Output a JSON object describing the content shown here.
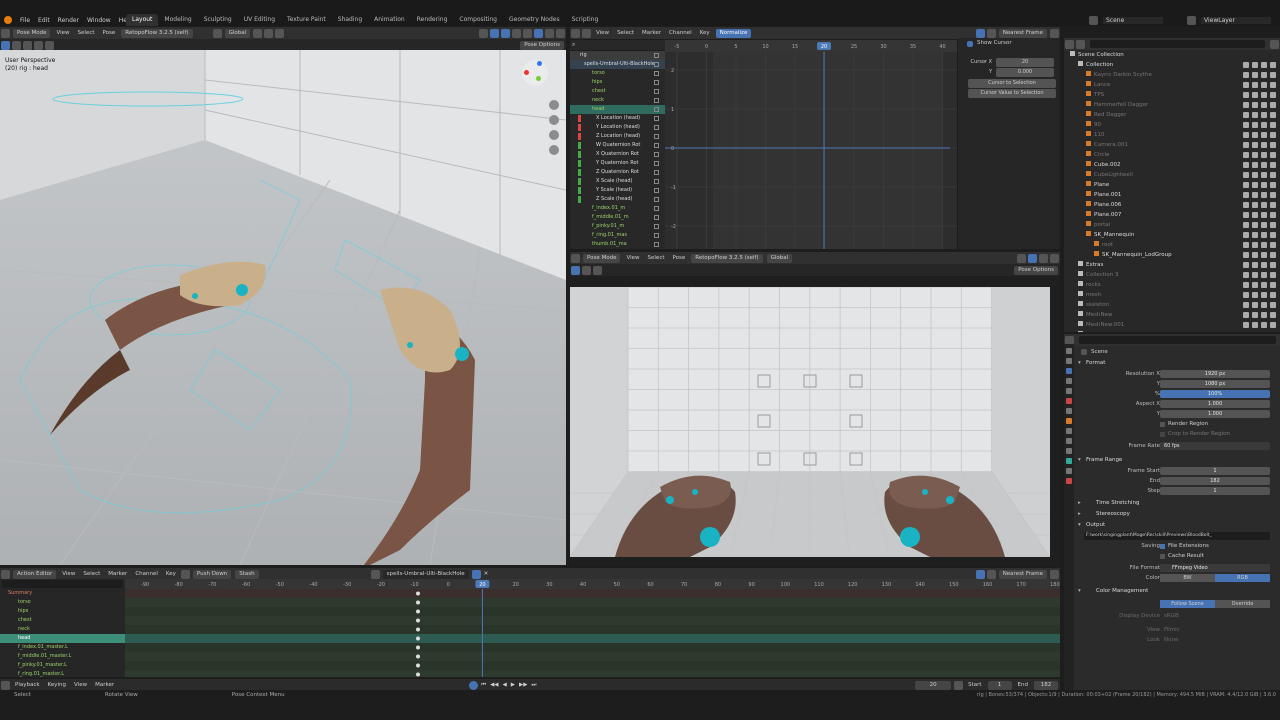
{
  "app_menu": [
    "File",
    "Edit",
    "Render",
    "Window",
    "Help"
  ],
  "workspaces": [
    "Layout",
    "Modeling",
    "Sculpting",
    "UV Editing",
    "Texture Paint",
    "Shading",
    "Animation",
    "Rendering",
    "Compositing",
    "Geometry Nodes",
    "Scripting"
  ],
  "active_workspace": "Layout",
  "scene_name": "Scene",
  "view_layer": "ViewLayer",
  "viewport3d": {
    "header": {
      "mode": "Pose Mode",
      "menus": [
        "View",
        "Select",
        "Pose"
      ],
      "addon": "RetopoFlow 3.2.5 (self)",
      "orientation": "Global",
      "options": "Pose Options"
    },
    "overlay_title": "User Perspective",
    "overlay_sub": "(20) rig : head"
  },
  "graph_editor": {
    "header": {
      "menus": [
        "View",
        "Select",
        "Marker",
        "Channel",
        "Key"
      ],
      "normalize": "Normalize",
      "pivot": "Nearest Frame"
    },
    "channels": [
      {
        "name": "rig",
        "type": "obj"
      },
      {
        "name": "spells-Umbral-Ulti-BlackHole",
        "type": "action"
      },
      {
        "name": "torso",
        "type": "bone"
      },
      {
        "name": "hips",
        "type": "bone"
      },
      {
        "name": "chest",
        "type": "bone"
      },
      {
        "name": "neck",
        "type": "bone"
      },
      {
        "name": "head",
        "type": "bone-sel"
      },
      {
        "name": "X Location (head)",
        "type": "fc"
      },
      {
        "name": "Y Location (head)",
        "type": "fc"
      },
      {
        "name": "Z Location (head)",
        "type": "fc"
      },
      {
        "name": "W Quaternion Rot",
        "type": "fc"
      },
      {
        "name": "X Quaternion Rot",
        "type": "fc"
      },
      {
        "name": "Y Quaternion Rot",
        "type": "fc"
      },
      {
        "name": "Z Quaternion Rot",
        "type": "fc"
      },
      {
        "name": "X Scale (head)",
        "type": "fc"
      },
      {
        "name": "Y Scale (head)",
        "type": "fc"
      },
      {
        "name": "Z Scale (head)",
        "type": "fc"
      },
      {
        "name": "f_index.01_m",
        "type": "bone"
      },
      {
        "name": "f_middle.01_m",
        "type": "bone"
      },
      {
        "name": "f_pinky.01_m",
        "type": "bone"
      },
      {
        "name": "f_ring.01_mas",
        "type": "bone"
      },
      {
        "name": "thumb.01_ma",
        "type": "bone"
      }
    ],
    "ruler": [
      "-5",
      "0",
      "5",
      "10",
      "15",
      "20",
      "25",
      "30",
      "35",
      "40"
    ],
    "current_frame": "20",
    "y_ticks": [
      "2",
      "1",
      "0",
      "-1",
      "-2"
    ],
    "npanel": {
      "show_cursor": "Show Cursor",
      "cursor_x_label": "Cursor X",
      "cursor_x": "20",
      "cursor_y_label": "Y",
      "cursor_y": "0.000",
      "btn1": "Cursor to Selection",
      "btn2": "Cursor Value to Selection"
    }
  },
  "viewport2": {
    "header": {
      "mode": "Pose Mode",
      "menus": [
        "View",
        "Select",
        "Pose"
      ],
      "addon": "RetopoFlow 3.2.5 (self)",
      "orientation": "Global",
      "options": "Pose Options"
    }
  },
  "outliner": {
    "items": [
      {
        "name": "Scene Collection",
        "indent": 0,
        "color": "#ddd"
      },
      {
        "name": "Collection",
        "indent": 1,
        "color": "#ddd"
      },
      {
        "name": "Kayrrc Darkin Scythe",
        "indent": 2,
        "color": "#777"
      },
      {
        "name": "Lance",
        "indent": 2,
        "color": "#777"
      },
      {
        "name": "TPS",
        "indent": 2,
        "color": "#777"
      },
      {
        "name": "Hammerfell Dagger",
        "indent": 2,
        "color": "#777"
      },
      {
        "name": "Red Dagger",
        "indent": 2,
        "color": "#777"
      },
      {
        "name": "90",
        "indent": 2,
        "color": "#777"
      },
      {
        "name": "110",
        "indent": 2,
        "color": "#777"
      },
      {
        "name": "Camera.001",
        "indent": 2,
        "color": "#777"
      },
      {
        "name": "Circle",
        "indent": 2,
        "color": "#777"
      },
      {
        "name": "Cube.002",
        "indent": 2,
        "color": "#ddd"
      },
      {
        "name": "CubeLightwell",
        "indent": 2,
        "color": "#777"
      },
      {
        "name": "Plane",
        "indent": 2,
        "color": "#ddd"
      },
      {
        "name": "Plane.001",
        "indent": 2,
        "color": "#ddd"
      },
      {
        "name": "Plane.006",
        "indent": 2,
        "color": "#ddd"
      },
      {
        "name": "Plane.007",
        "indent": 2,
        "color": "#ddd"
      },
      {
        "name": "portal",
        "indent": 2,
        "color": "#777"
      },
      {
        "name": "SK_Mannequin",
        "indent": 2,
        "color": "#ddd"
      },
      {
        "name": "root",
        "indent": 3,
        "color": "#777"
      },
      {
        "name": "SK_Mannequin_LodGroup",
        "indent": 3,
        "color": "#ddd"
      },
      {
        "name": "Extras",
        "indent": 1,
        "color": "#ddd"
      },
      {
        "name": "Collection 3",
        "indent": 1,
        "color": "#777"
      },
      {
        "name": "rocks",
        "indent": 1,
        "color": "#777"
      },
      {
        "name": "mesh",
        "indent": 1,
        "color": "#777"
      },
      {
        "name": "skeleton",
        "indent": 1,
        "color": "#777"
      },
      {
        "name": "MeshNew",
        "indent": 1,
        "color": "#777"
      },
      {
        "name": "MeshNew.001",
        "indent": 1,
        "color": "#777"
      },
      {
        "name": "Crossbow.R",
        "indent": 1,
        "color": "#777"
      }
    ]
  },
  "properties": {
    "context": "Scene",
    "format_label": "Format",
    "res_x_label": "Resolution X",
    "res_x": "1920 px",
    "res_y_label": "Y",
    "res_y": "1080 px",
    "res_pct_label": "%",
    "res_pct": "100%",
    "aspect_x_label": "Aspect X",
    "aspect_x": "1.000",
    "aspect_y_label": "Y",
    "aspect_y": "1.000",
    "render_region": "Render Region",
    "crop_region": "Crop to Render Region",
    "frame_rate_label": "Frame Rate",
    "frame_rate": "60 fps",
    "frame_range_label": "Frame Range",
    "frame_start_label": "Frame Start",
    "frame_start": "1",
    "frame_end_label": "End",
    "frame_end": "182",
    "frame_step_label": "Step",
    "frame_step": "1",
    "time_stretching": "Time Stretching",
    "stereoscopy": "Stereoscopy",
    "output_label": "Output",
    "output_path": "F:\\work\\singingplant\\Mage\\Rec\\skill\\Previews\\BloodBolt_",
    "saving_label": "Saving",
    "file_extensions": "File Extensions",
    "cache_result": "Cache Result",
    "file_format_label": "File Format",
    "file_format": "FFmpeg Video",
    "color_label": "Color",
    "color_bw": "BW",
    "color_rgb": "RGB",
    "color_mgmt": "Color Management",
    "follow_scene": "Follow Scene",
    "override": "Override",
    "display_device_label": "Display Device",
    "display_device": "sRGB",
    "view_label": "View",
    "view_value": "Filmic",
    "look_label": "Look",
    "look_value": "None"
  },
  "action_editor": {
    "header": {
      "editor": "Action Editor",
      "menus": [
        "View",
        "Select",
        "Marker",
        "Channel",
        "Key"
      ],
      "push_down": "Push Down",
      "stash": "Stash",
      "action_name": "spells-Umbral-Ulti-BlackHole",
      "pivot": "Nearest Frame"
    },
    "ruler": [
      "-90",
      "-80",
      "-70",
      "-60",
      "-50",
      "-40",
      "-30",
      "-20",
      "-10",
      "0",
      "10",
      "20",
      "30",
      "40",
      "50",
      "60",
      "70",
      "80",
      "90",
      "100",
      "110",
      "120",
      "130",
      "140",
      "150",
      "160",
      "170",
      "180"
    ],
    "current_frame": "20",
    "rows": [
      {
        "name": "Summary",
        "type": "summ"
      },
      {
        "name": "torso",
        "type": "norm"
      },
      {
        "name": "hips",
        "type": "norm"
      },
      {
        "name": "chest",
        "type": "norm"
      },
      {
        "name": "neck",
        "type": "norm"
      },
      {
        "name": "head",
        "type": "sel"
      },
      {
        "name": "f_index.01_master.L",
        "type": "norm"
      },
      {
        "name": "f_middle.01_master.L",
        "type": "norm"
      },
      {
        "name": "f_pinky.01_master.L",
        "type": "norm"
      },
      {
        "name": "f_ring.01_master.L",
        "type": "norm"
      }
    ]
  },
  "timeline": {
    "menus": [
      "Playback",
      "Keying",
      "View",
      "Marker"
    ],
    "frame": "20",
    "start_label": "Start",
    "start": "1",
    "end_label": "End",
    "end": "182"
  },
  "statusbar": {
    "select": "Select",
    "rotate_view": "Rotate View",
    "context_menu": "Pose Context Menu",
    "stats": "rig | Bones:53/374 | Objects:1/9 | Duration: 00:03+02 (Frame 20/182) | Memory: 494.5 MiB | VRAM: 4.4/12.0 GiB | 3.6.0"
  }
}
